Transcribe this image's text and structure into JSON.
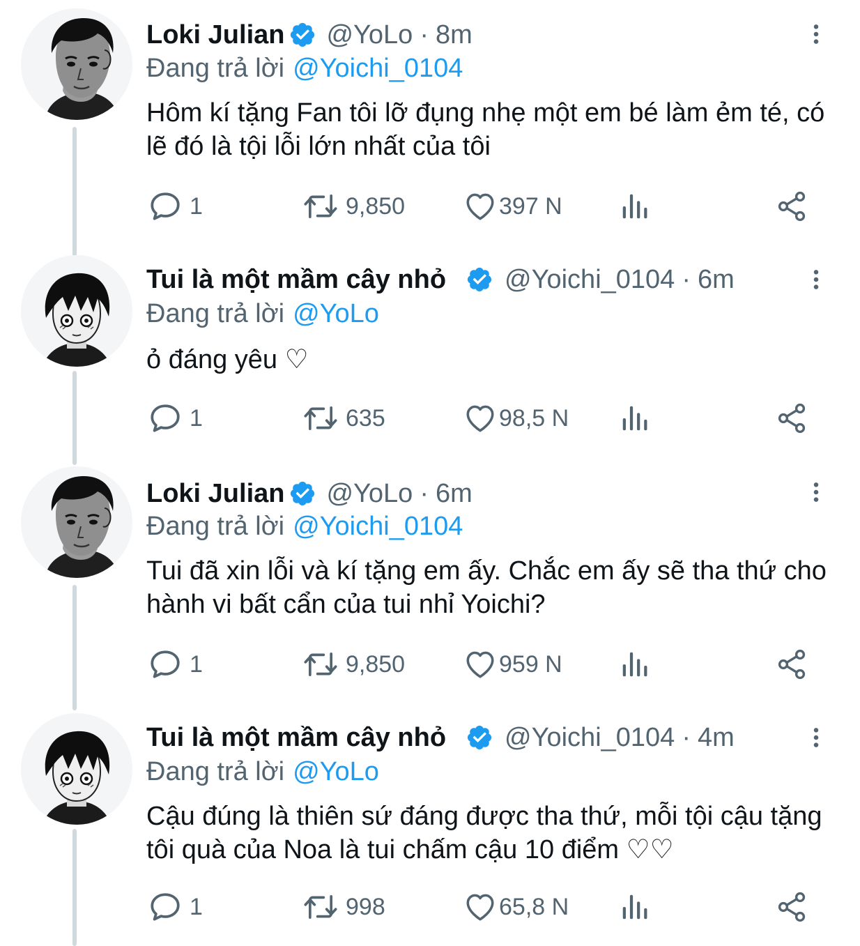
{
  "tweets": [
    {
      "name": "Loki Julian",
      "handle": "@YoLo",
      "separator": "·",
      "time": "8m",
      "replying_label": "Đang trả lời",
      "replying_to": "@Yoichi_0104",
      "text": "Hôm kí tặng Fan tôi lỡ đụng nhẹ một em bé làm ẻm té, có lẽ đó là tội lỗi lớn nhất của tôi",
      "replies": "1",
      "retweets": "9,850",
      "likes": "397 N",
      "avatar": "loki-avatar"
    },
    {
      "name": "Tui là một mầm cây nhỏ",
      "handle": "@Yoichi_0104",
      "separator": "·",
      "time": "6m",
      "replying_label": "Đang trả lời",
      "replying_to": "@YoLo",
      "text": "ỏ đáng yêu ♡",
      "replies": "1",
      "retweets": "635",
      "likes": "98,5 N",
      "avatar": "yoichi-avatar"
    },
    {
      "name": "Loki Julian",
      "handle": "@YoLo",
      "separator": "·",
      "time": "6m",
      "replying_label": "Đang trả lời",
      "replying_to": "@Yoichi_0104",
      "text": "Tui đã xin lỗi và kí tặng em ấy. Chắc em ấy sẽ tha thứ cho hành vi bất cẩn của tui nhỉ Yoichi?",
      "replies": "1",
      "retweets": "9,850",
      "likes": "959 N",
      "avatar": "loki-avatar"
    },
    {
      "name": "Tui là một mầm cây nhỏ",
      "handle": "@Yoichi_0104",
      "separator": "·",
      "time": "4m",
      "replying_label": "Đang trả lời",
      "replying_to": "@YoLo",
      "text": "Cậu đúng là thiên sứ đáng được tha thứ, mỗi tội cậu tặng tôi quà của Noa là tui chấm cậu 10 điểm ♡♡",
      "replies": "1",
      "retweets": "998",
      "likes": "65,8 N",
      "avatar": "yoichi-avatar"
    }
  ],
  "icons": {
    "verified": "verified-badge-icon",
    "more": "more-vertical-icon",
    "reply": "reply-icon",
    "retweet": "retweet-icon",
    "like": "heart-icon",
    "views": "views-icon",
    "share": "share-icon"
  },
  "colors": {
    "accent": "#1d9bf0",
    "secondary_text": "#536471",
    "primary_text": "#0f1419",
    "thread_line": "#cfd9de"
  }
}
